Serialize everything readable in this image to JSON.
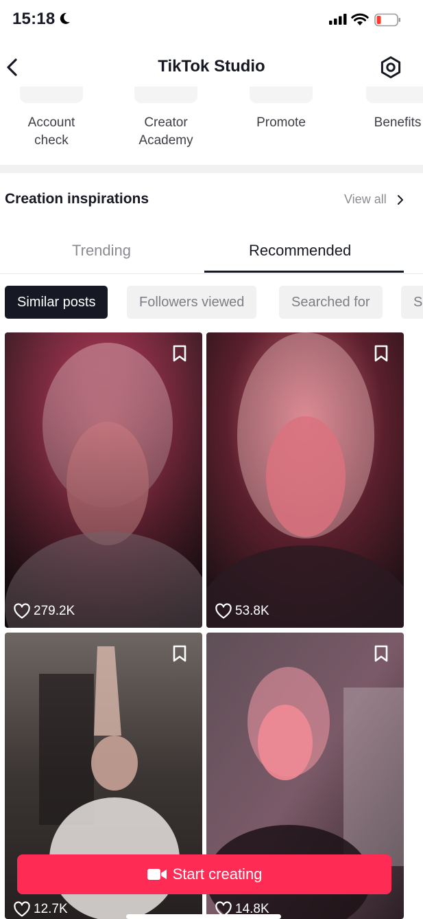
{
  "status_bar": {
    "time": "15:18"
  },
  "header": {
    "title": "TikTok Studio",
    "back_icon": "chevron-left-icon",
    "settings_icon": "gear-icon"
  },
  "tools": [
    {
      "label": "Account\ncheck"
    },
    {
      "label": "Creator\nAcademy"
    },
    {
      "label": "Promote"
    },
    {
      "label": "Benefits"
    }
  ],
  "inspirations": {
    "title": "Creation inspirations",
    "view_all": "View all",
    "tabs": [
      {
        "label": "Trending",
        "selected": false
      },
      {
        "label": "Recommended",
        "selected": true
      }
    ],
    "chips": [
      {
        "label": "Similar posts",
        "selected": true
      },
      {
        "label": "Followers viewed",
        "selected": false
      },
      {
        "label": "Searched for",
        "selected": false
      },
      {
        "label": "S",
        "selected": false
      }
    ],
    "posts": [
      {
        "likes": "279.2K"
      },
      {
        "likes": "53.8K"
      },
      {
        "likes": "12.7K"
      },
      {
        "likes": "14.8K"
      }
    ]
  },
  "cta": {
    "label": "Start creating",
    "icon": "video-camera-icon"
  },
  "colors": {
    "accent": "#fe2c55",
    "text": "#161823",
    "muted": "#8a8b91"
  }
}
